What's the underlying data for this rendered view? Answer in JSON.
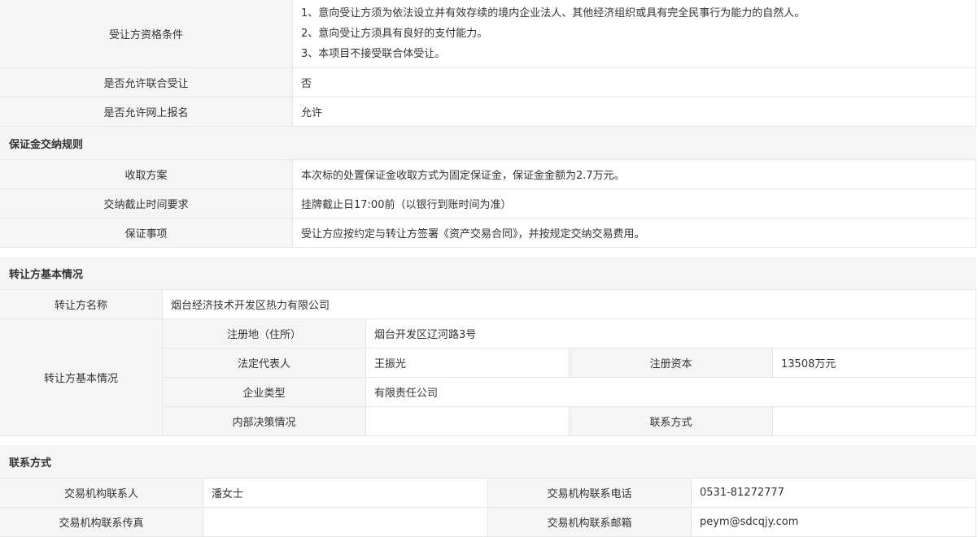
{
  "eligibility": {
    "label": "受让方资格条件",
    "lines": [
      "1、意向受让方须为依法设立并有效存续的境内企业法人、其他经济组织或具有完全民事行为能力的自然人。",
      "2、意向受让方须具有良好的支付能力。",
      "3、本项目不接受联合体受让。"
    ]
  },
  "joint": {
    "label": "是否允许联合受让",
    "value": "否"
  },
  "online": {
    "label": "是否允许网上报名",
    "value": "允许"
  },
  "deposit": {
    "title": "保证金交纳规则",
    "rows": [
      {
        "label": "收取方案",
        "value": "本次标的处置保证金收取方式为固定保证金，保证金金额为2.7万元。"
      },
      {
        "label": "交纳截止时间要求",
        "value": "挂牌截止日17:00前（以银行到账时间为准）"
      },
      {
        "label": "保证事项",
        "value": "受让方应按约定与转让方签署《资产交易合同》，并按规定交纳交易费用。"
      }
    ]
  },
  "transferor": {
    "title": "转让方基本情况",
    "name_label": "转让方名称",
    "name_value": "烟台经济技术开发区热力有限公司",
    "basic_label": "转让方基本情况",
    "address_label": "注册地（住所）",
    "address_value": "烟台开发区辽河路3号",
    "rep_label": "法定代表人",
    "rep_value": "王振光",
    "capital_label": "注册资本",
    "capital_value": "13508万元",
    "type_label": "企业类型",
    "type_value": "有限责任公司",
    "decision_label": "内部决策情况",
    "decision_value": "",
    "contact_label": "联系方式",
    "contact_value": ""
  },
  "contact": {
    "title": "联系方式",
    "person_label": "交易机构联系人",
    "person_value": "潘女士",
    "phone_label": "交易机构联系电话",
    "phone_value": "0531-81272777",
    "fax_label": "交易机构联系传真",
    "fax_value": "",
    "email_label": "交易机构联系邮箱",
    "email_value": "peym@sdcqjy.com"
  }
}
